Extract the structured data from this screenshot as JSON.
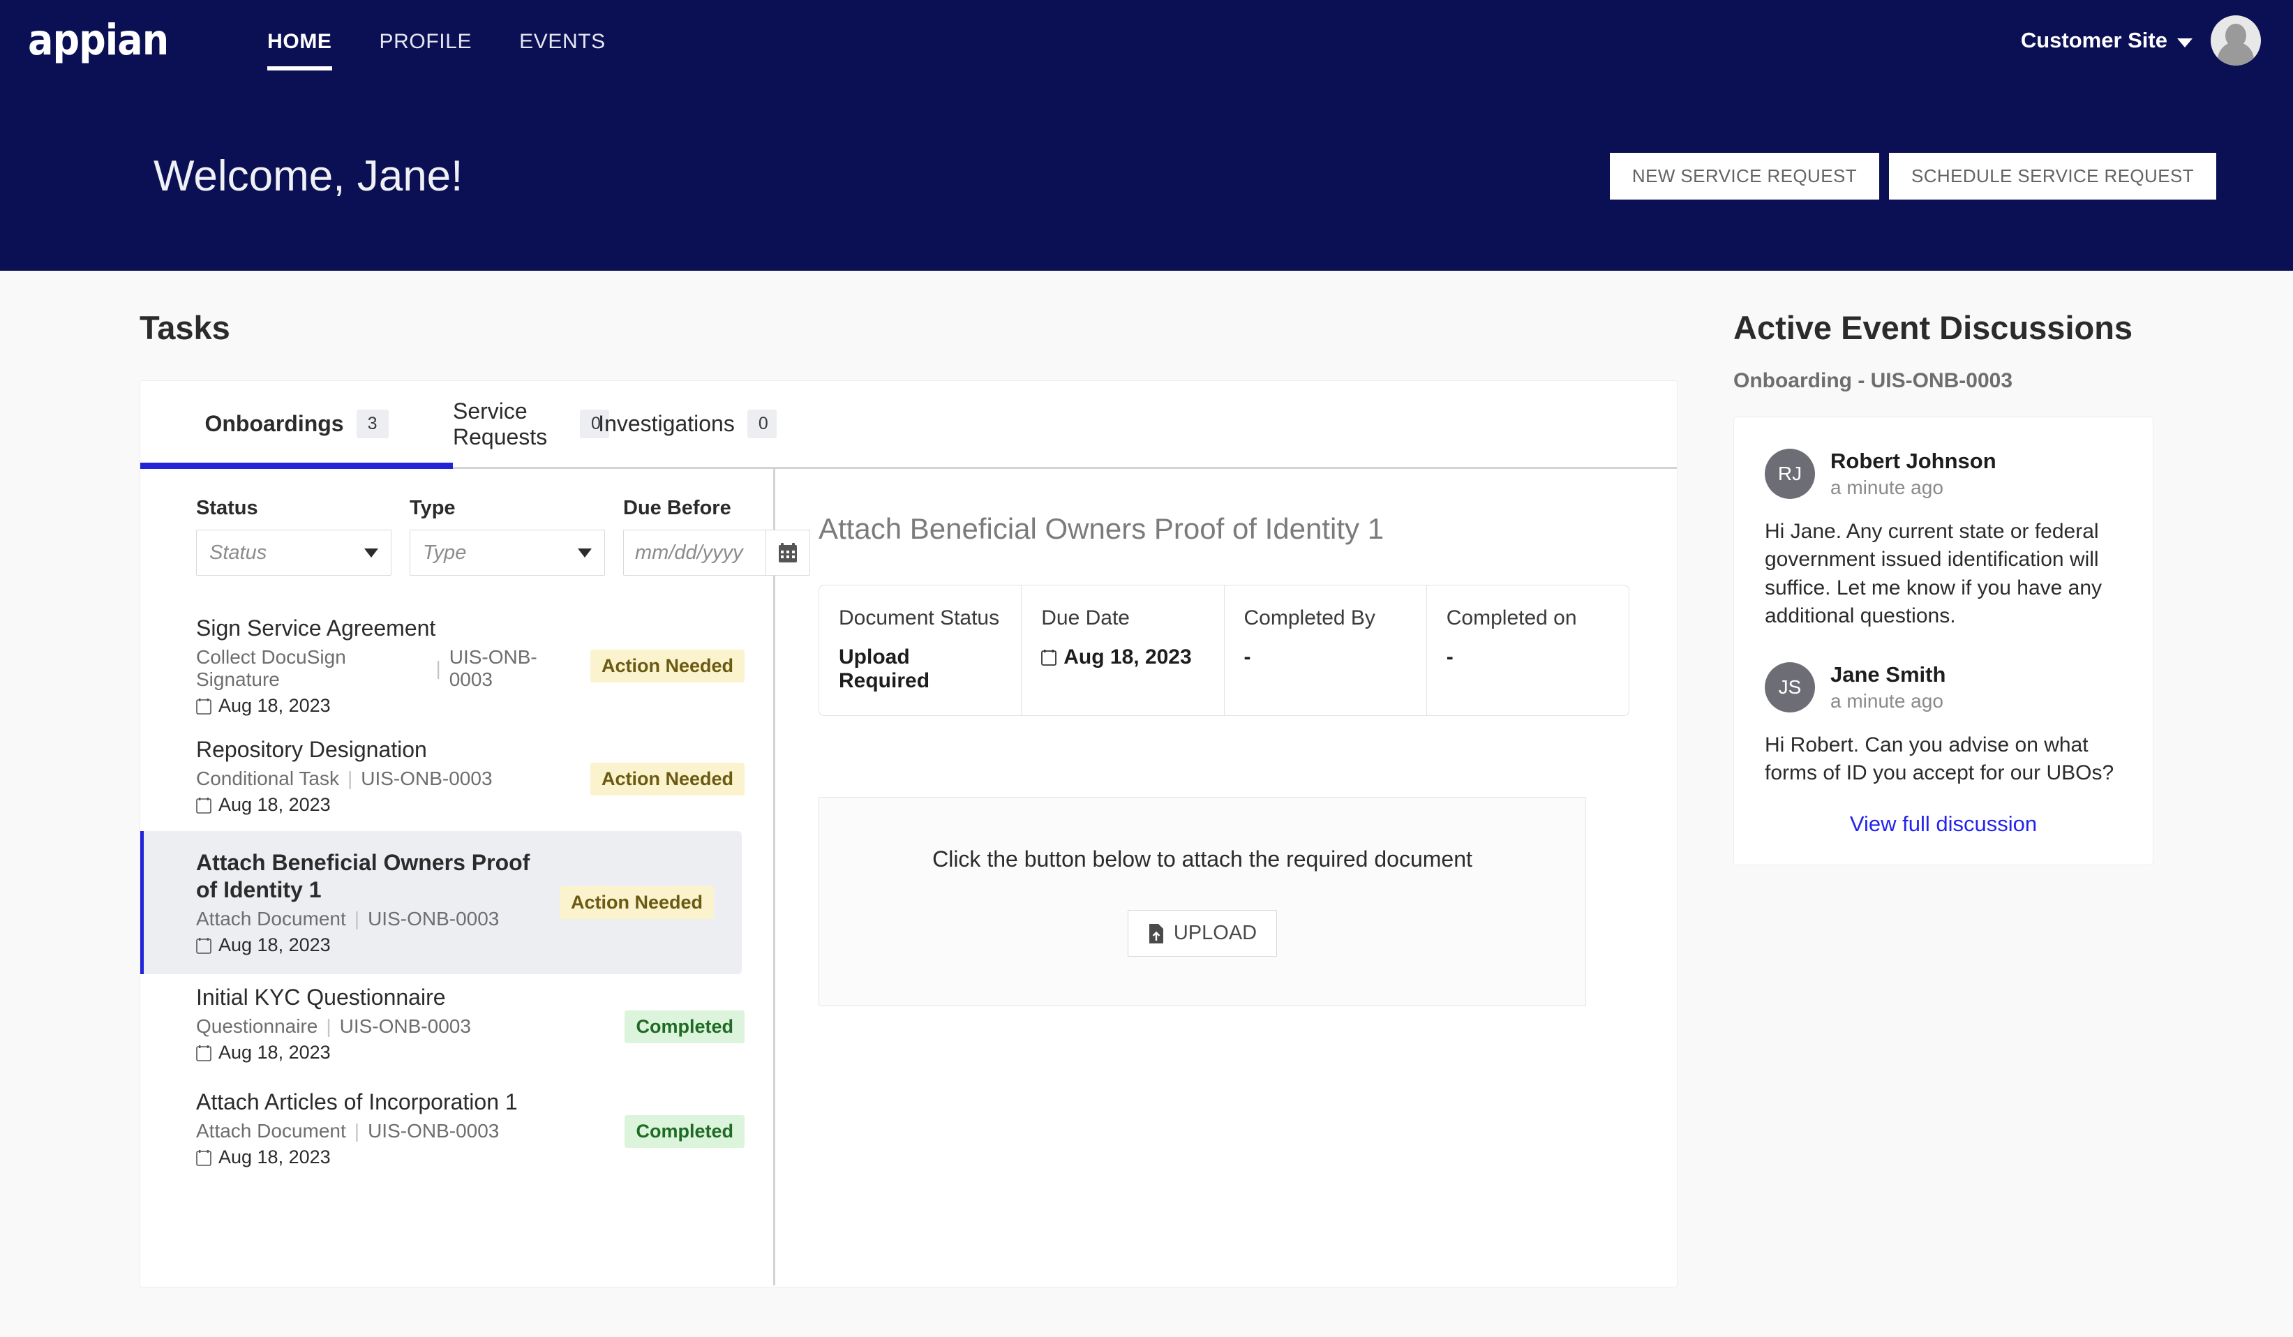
{
  "header": {
    "logo": "appian",
    "nav": [
      {
        "label": "HOME",
        "active": true
      },
      {
        "label": "PROFILE",
        "active": false
      },
      {
        "label": "EVENTS",
        "active": false
      }
    ],
    "site_switcher": "Customer Site",
    "accent_color": "#0b1055"
  },
  "banner": {
    "welcome": "Welcome, Jane!",
    "buttons": [
      {
        "label": "NEW SERVICE REQUEST"
      },
      {
        "label": "SCHEDULE SERVICE REQUEST"
      }
    ]
  },
  "tasks": {
    "section_title": "Tasks",
    "tabs": [
      {
        "label": "Onboardings",
        "count": "3",
        "active": true
      },
      {
        "label": "Service Requests",
        "count": "0",
        "active": false
      },
      {
        "label": "Investigations",
        "count": "0",
        "active": false
      }
    ],
    "filters": {
      "status": {
        "label": "Status",
        "placeholder": "Status"
      },
      "type": {
        "label": "Type",
        "placeholder": "Type"
      },
      "due_before": {
        "label": "Due Before",
        "placeholder": "mm/dd/yyyy",
        "value": ""
      }
    },
    "items": [
      {
        "title": "Sign Service Agreement",
        "type": "Collect DocuSign Signature",
        "ref": "UIS-ONB-0003",
        "date": "Aug 18, 2023",
        "status": "Action Needed",
        "status_kind": "action",
        "selected": false
      },
      {
        "title": "Repository Designation",
        "type": "Conditional Task",
        "ref": "UIS-ONB-0003",
        "date": "Aug 18, 2023",
        "status": "Action Needed",
        "status_kind": "action",
        "selected": false
      },
      {
        "title": "Attach Beneficial Owners Proof of Identity 1",
        "type": "Attach Document",
        "ref": "UIS-ONB-0003",
        "date": "Aug 18, 2023",
        "status": "Action Needed",
        "status_kind": "action",
        "selected": true
      },
      {
        "title": "Initial KYC Questionnaire",
        "type": "Questionnaire",
        "ref": "UIS-ONB-0003",
        "date": "Aug 18, 2023",
        "status": "Completed",
        "status_kind": "done",
        "selected": false
      },
      {
        "title": "Attach Articles of Incorporation 1",
        "type": "Attach Document",
        "ref": "UIS-ONB-0003",
        "date": "Aug 18, 2023",
        "status": "Completed",
        "status_kind": "done",
        "selected": false
      }
    ]
  },
  "detail": {
    "title": "Attach Beneficial Owners Proof of Identity 1",
    "table": {
      "headers": [
        "Document Status",
        "Due Date",
        "Completed By",
        "Completed on"
      ],
      "values": [
        "Upload Required",
        "Aug 18, 2023",
        "-",
        "-"
      ]
    },
    "upload": {
      "hint": "Click the button below to attach the required document",
      "button_label": "UPLOAD"
    }
  },
  "discussions": {
    "title": "Active Event Discussions",
    "subtitle": "Onboarding - UIS-ONB-0003",
    "messages": [
      {
        "initials": "RJ",
        "name": "Robert Johnson",
        "time": "a minute ago",
        "body": "Hi Jane. Any current state or federal government issued identification will suffice. Let me know if you have any additional questions."
      },
      {
        "initials": "JS",
        "name": "Jane Smith",
        "time": "a minute ago",
        "body": "Hi Robert. Can you advise on what forms of ID you accept for our UBOs?"
      }
    ],
    "view_link": "View full discussion"
  }
}
